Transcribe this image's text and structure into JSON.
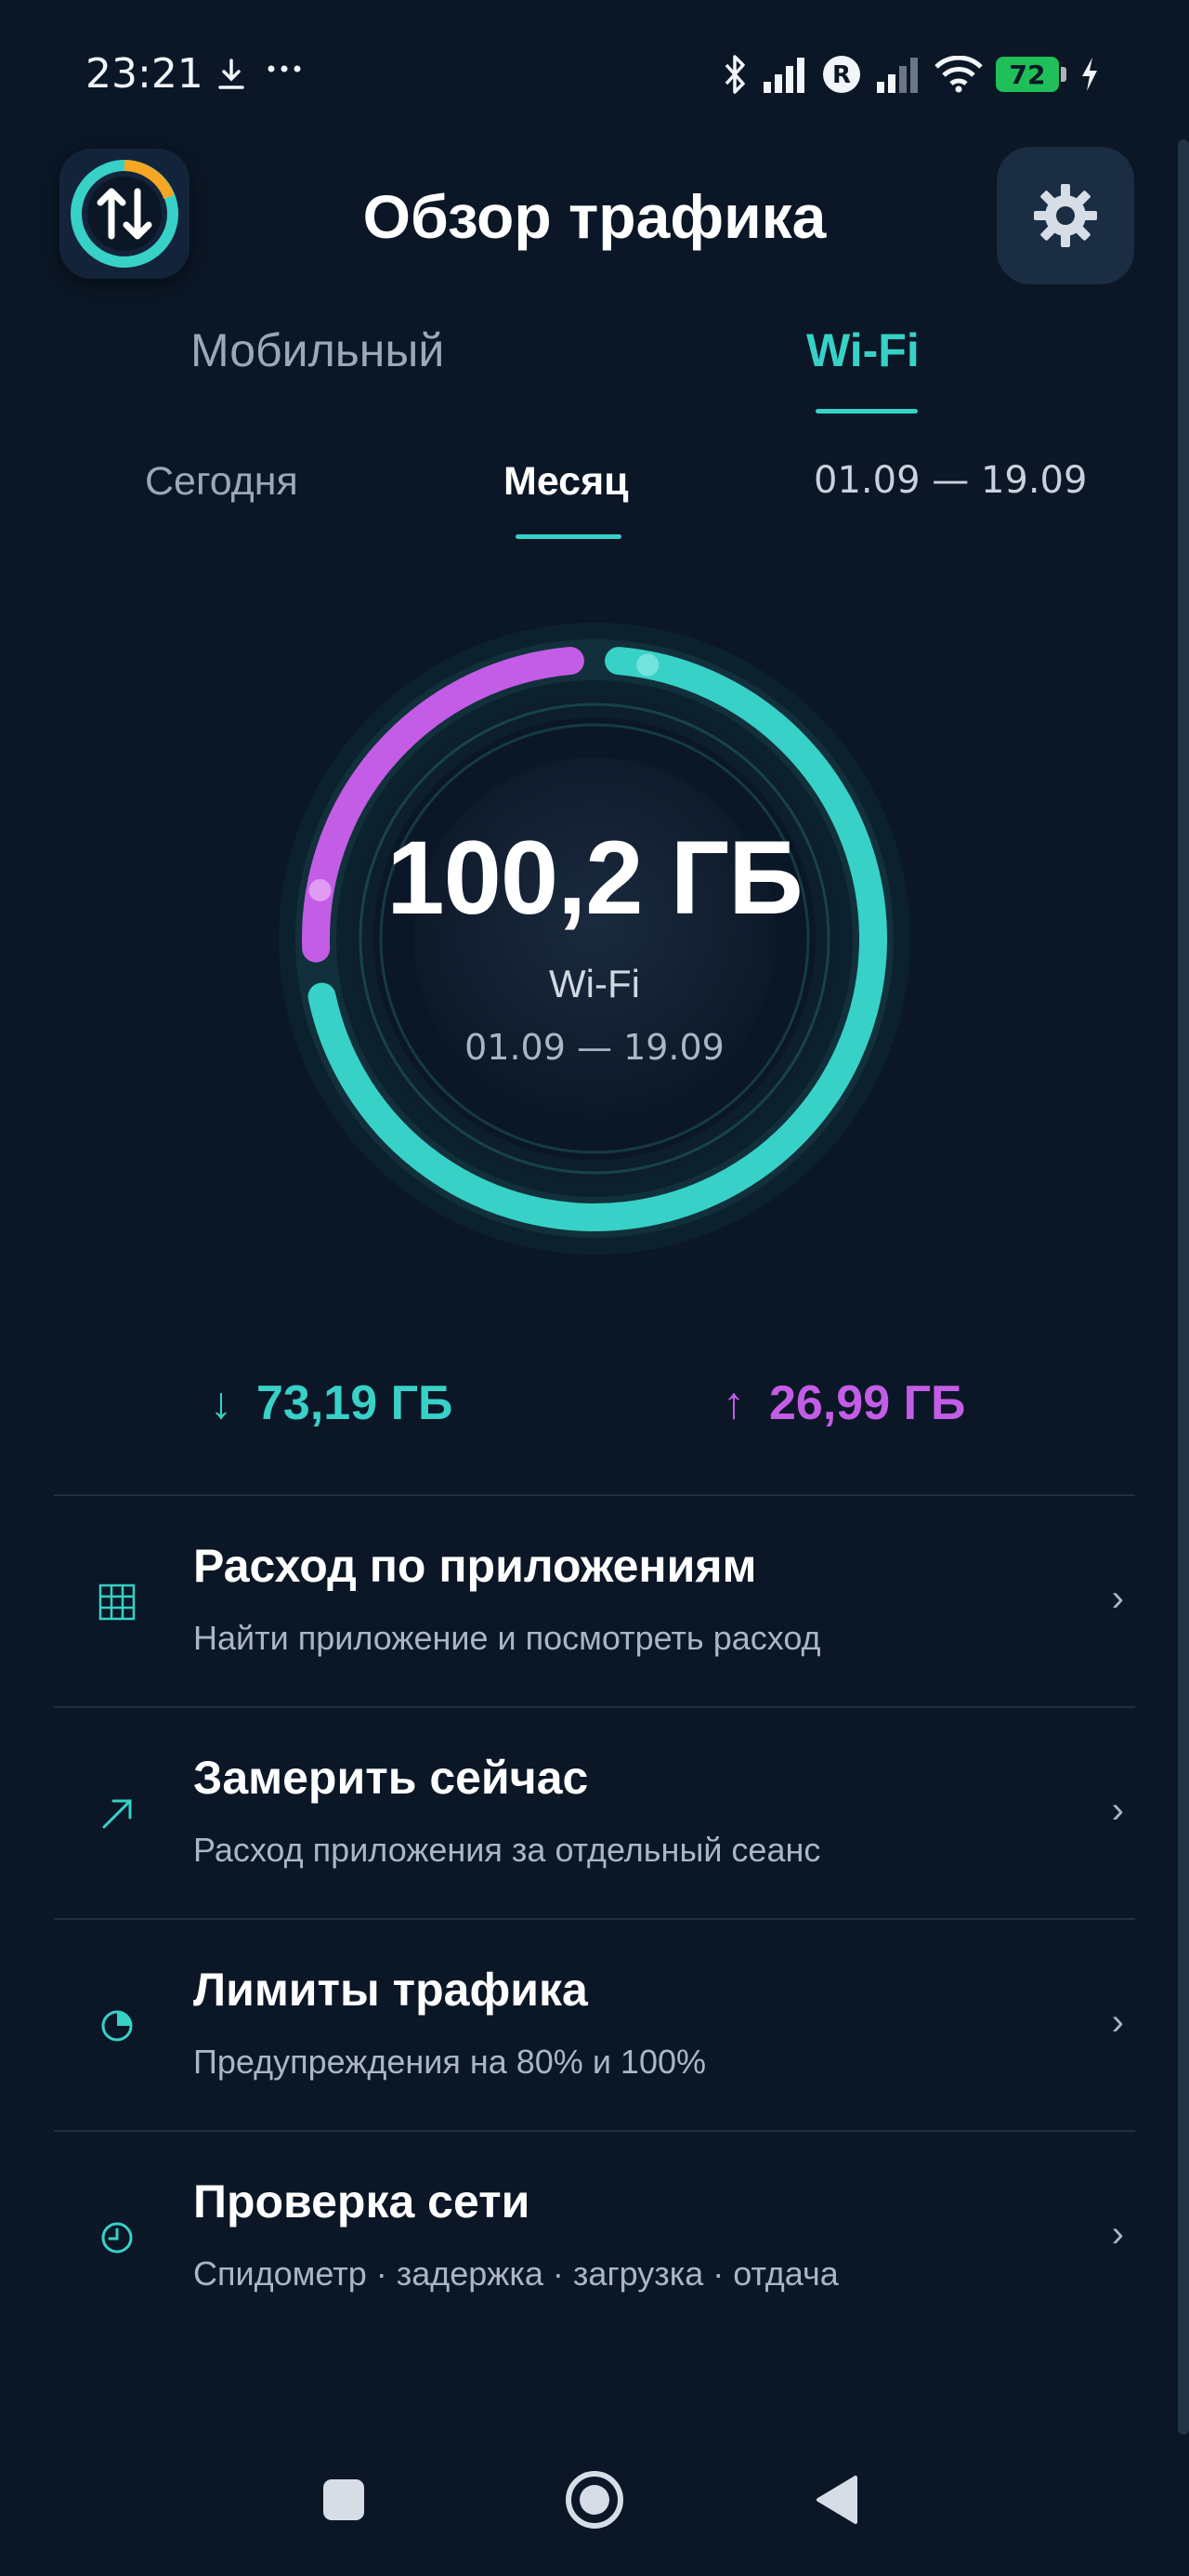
{
  "status_bar": {
    "time": "23:21",
    "battery": "72",
    "icons": [
      "download-icon",
      "more-icon",
      "bluetooth-icon",
      "signal-icon",
      "roaming-icon",
      "signal-icon",
      "wifi-icon",
      "battery-icon",
      "charging-icon"
    ]
  },
  "header": {
    "title": "Обзор трафика"
  },
  "network_tabs": [
    {
      "label": "Мобильный",
      "selected": false
    },
    {
      "label": "Wi-Fi",
      "selected": true
    }
  ],
  "period_tabs": [
    {
      "label": "Сегодня",
      "selected": false
    },
    {
      "label": "Месяц",
      "selected": true
    },
    {
      "label": "01.09 — 19.09",
      "selected": false
    }
  ],
  "gauge": {
    "total": "100,2 ГБ",
    "label": "Wi-Fi",
    "range": "01.09 — 19.09",
    "download_fraction": 0.7305,
    "upload_fraction": 0.2695
  },
  "totals": {
    "download": "73,19 ГБ",
    "upload": "26,99 ГБ",
    "download_arrow": "↓",
    "upload_arrow": "↑"
  },
  "menu": [
    {
      "title": "Расход по приложениям",
      "subtitle": "Найти приложение и посмотреть расход",
      "icon": "grid-icon"
    },
    {
      "title": "Замерить сейчас",
      "subtitle": "Расход приложения за отдельный сеанс",
      "icon": "trend-arrow-icon"
    },
    {
      "title": "Лимиты трафика",
      "subtitle": "Предупреждения на 80% и 100%",
      "icon": "pie-icon"
    },
    {
      "title": "Проверка сети",
      "subtitle": "Спидометр · задержка · загрузка · отдача",
      "icon": "clock-icon"
    }
  ],
  "menu_chevron": "›",
  "colors": {
    "background": "#0b1726",
    "accent_download": "#37d1c7",
    "accent_upload": "#c35de6"
  }
}
